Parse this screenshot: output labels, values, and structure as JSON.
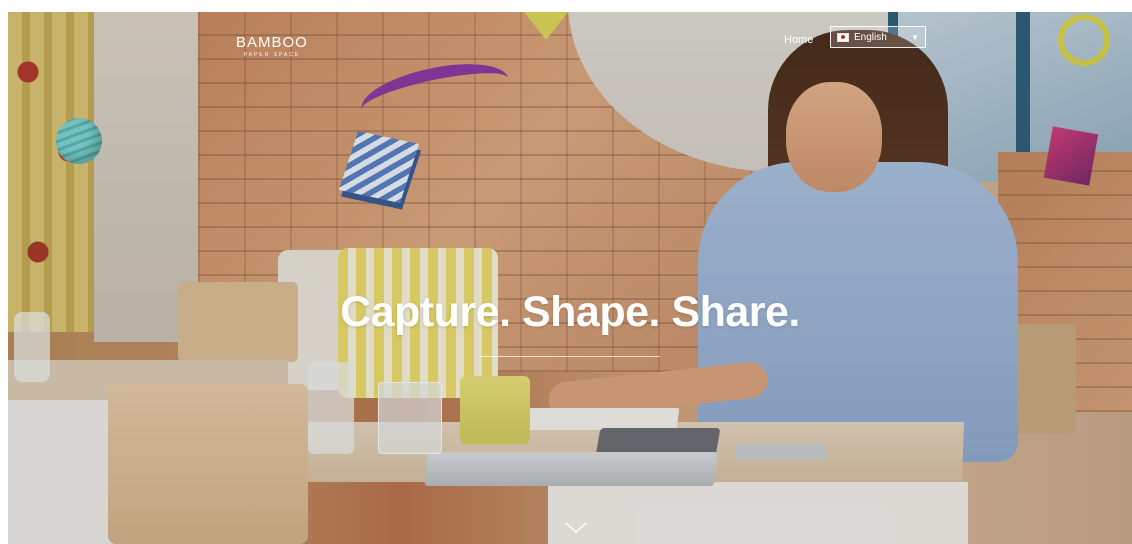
{
  "header": {
    "logo": "BAMBOO",
    "logo_tagline": "PAPER SPACE",
    "nav_home": "Home",
    "language": {
      "selected": "English",
      "flag": "japan-flag-icon"
    }
  },
  "hero": {
    "title": "Capture. Shape. Share."
  },
  "icons": {
    "scroll": "chevron-down-icon",
    "dropdown": "chevron-down-icon"
  },
  "colors": {
    "text": "#ffffff",
    "accent_yellow": "#d7d14b",
    "accent_purple": "#8a3aa0",
    "accent_teal": "#7fd4d1"
  }
}
